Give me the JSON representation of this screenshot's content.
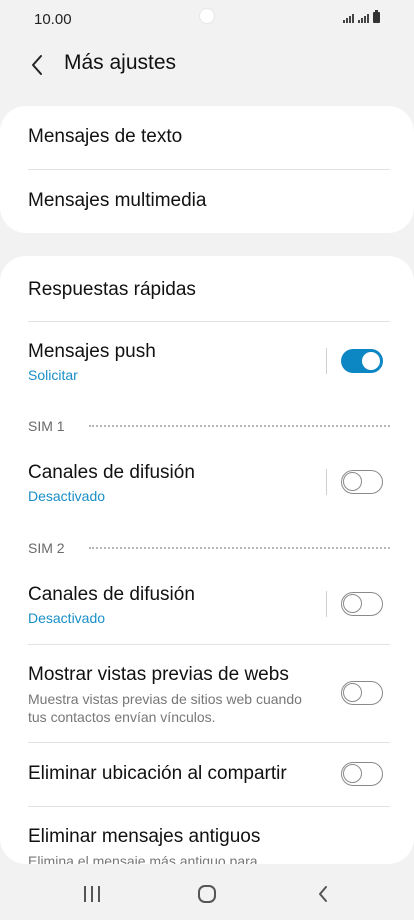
{
  "status": {
    "time": "10.00"
  },
  "header": {
    "title": "Más ajustes"
  },
  "group1": [
    {
      "label": "Mensajes de texto"
    },
    {
      "label": "Mensajes multimedia"
    }
  ],
  "group2": {
    "quick_replies": "Respuestas rápidas",
    "push": {
      "label": "Mensajes push",
      "sub": "Solicitar",
      "enabled": true
    },
    "sim1": {
      "label": "SIM 1",
      "title": "Canales de difusión",
      "sub": "Desactivado",
      "enabled": false
    },
    "sim2": {
      "label": "SIM 2",
      "title": "Canales de difusión",
      "sub": "Desactivado",
      "enabled": false
    },
    "web_previews": {
      "label": "Mostrar vistas previas de webs",
      "desc": "Muestra vistas previas de sitios web cuando tus contactos envían vínculos.",
      "enabled": false
    },
    "remove_location": {
      "label": "Eliminar ubicación al compartir",
      "enabled": false
    },
    "delete_old": {
      "label": "Eliminar mensajes antiguos",
      "desc": "Elimina el mensaje más antiguo para"
    }
  },
  "colors": {
    "accent": "#0d86c4",
    "link": "#1a8fc7",
    "background": "#f2f2f2"
  },
  "nav": {
    "icons": [
      "recent-apps-icon",
      "home-icon",
      "back-icon"
    ]
  }
}
